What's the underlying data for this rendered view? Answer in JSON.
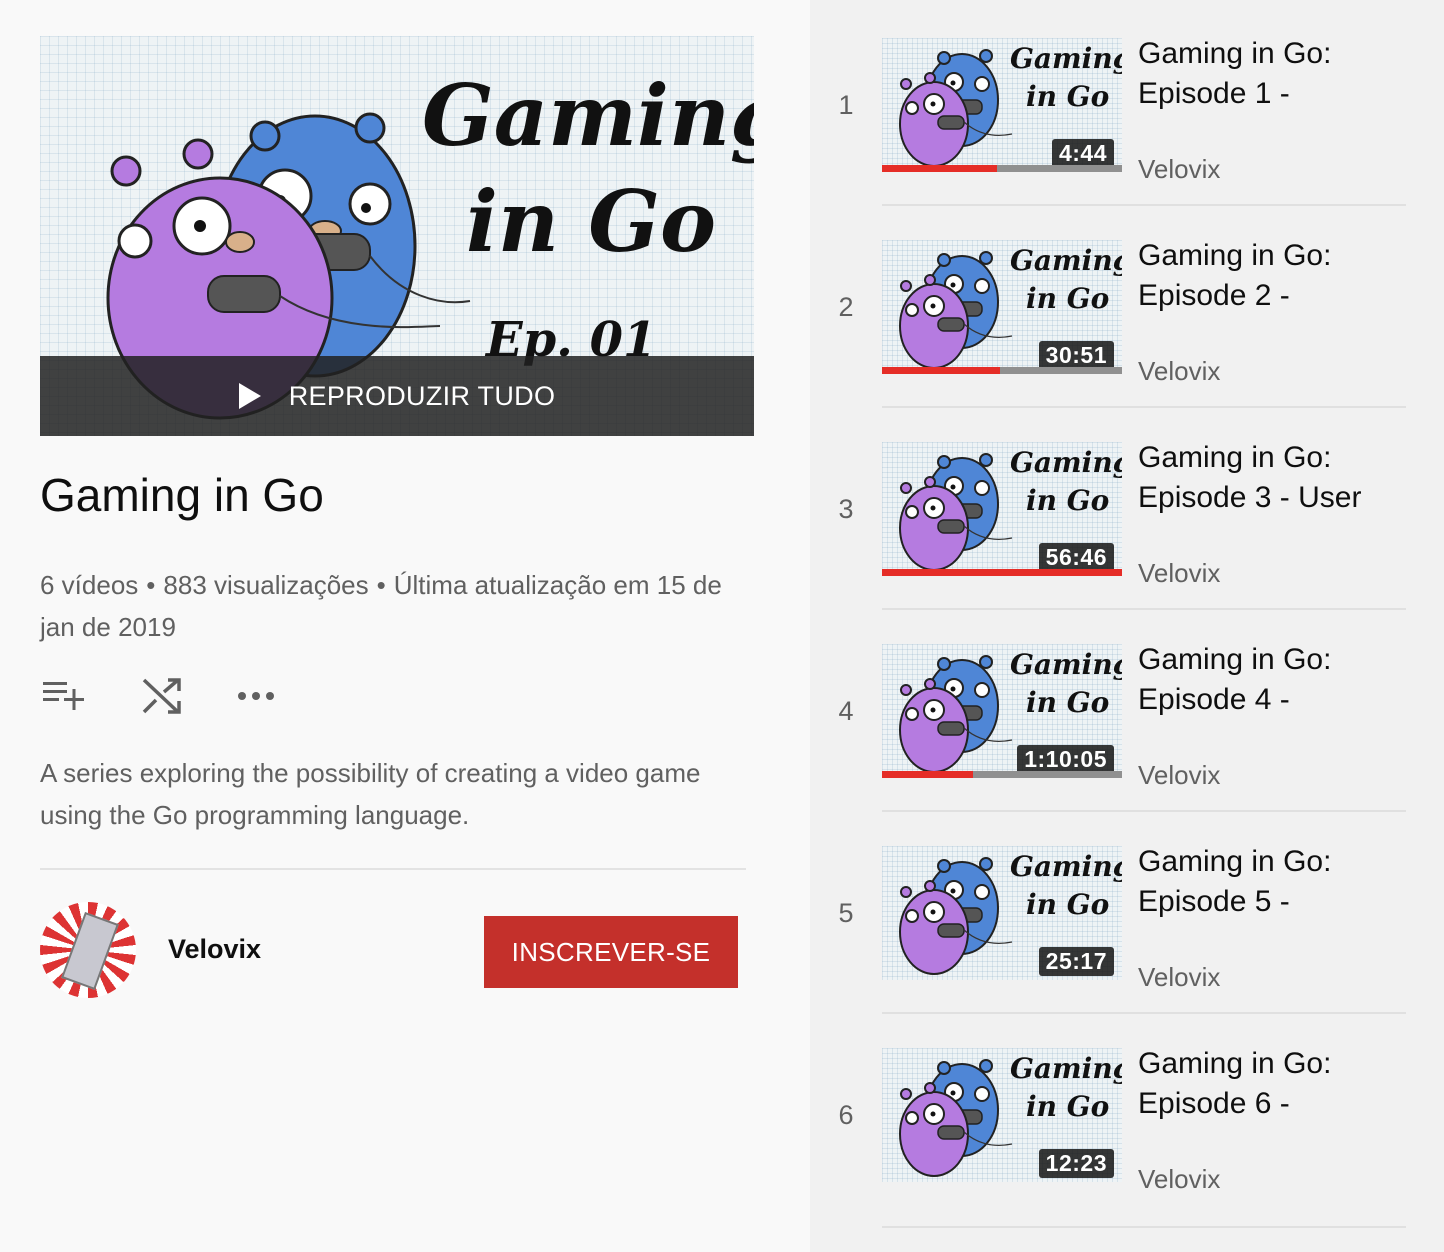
{
  "playlist": {
    "hero_title_line1": "Gaming",
    "hero_title_line2": "in Go",
    "hero_episode": "Ep. 01",
    "play_all_label": "REPRODUZIR TUDO",
    "title": "Gaming in Go",
    "video_count": "6 vídeos",
    "views": "883 visualizações",
    "updated": "Última atualização em 15 de jan de 2019",
    "separator": "•",
    "description": "A series exploring the possibility of creating a video game using the Go programming language.",
    "actions": [
      "add-to-queue-icon",
      "shuffle-icon",
      "more-options-icon"
    ]
  },
  "channel": {
    "name": "Velovix",
    "subscribe_label": "INSCREVER-SE"
  },
  "colors": {
    "accent": "#c4302b",
    "progress": "#e52d27"
  },
  "videos": [
    {
      "index": "1",
      "title": "Gaming in Go: Episode 1 -",
      "channel": "Velovix",
      "duration": "4:44",
      "thumb_line1": "Gaming",
      "thumb_line2": "in Go",
      "watched_fraction": 0.48
    },
    {
      "index": "2",
      "title": "Gaming in Go: Episode 2 -",
      "channel": "Velovix",
      "duration": "30:51",
      "thumb_line1": "Gaming",
      "thumb_line2": "in Go",
      "watched_fraction": 0.49
    },
    {
      "index": "3",
      "title": "Gaming in Go: Episode 3 - User",
      "channel": "Velovix",
      "duration": "56:46",
      "thumb_line1": "Gaming",
      "thumb_line2": "in Go",
      "watched_fraction": 1.0
    },
    {
      "index": "4",
      "title": "Gaming in Go: Episode 4 -",
      "channel": "Velovix",
      "duration": "1:10:05",
      "thumb_line1": "Gaming",
      "thumb_line2": "in Go",
      "watched_fraction": 0.38
    },
    {
      "index": "5",
      "title": "Gaming in Go: Episode 5 -",
      "channel": "Velovix",
      "duration": "25:17",
      "thumb_line1": "Gaming",
      "thumb_line2": "in Go",
      "watched_fraction": 0
    },
    {
      "index": "6",
      "title": "Gaming in Go: Episode 6 -",
      "channel": "Velovix",
      "duration": "12:23",
      "thumb_line1": "Gaming",
      "thumb_line2": "in Go",
      "watched_fraction": 0
    }
  ]
}
